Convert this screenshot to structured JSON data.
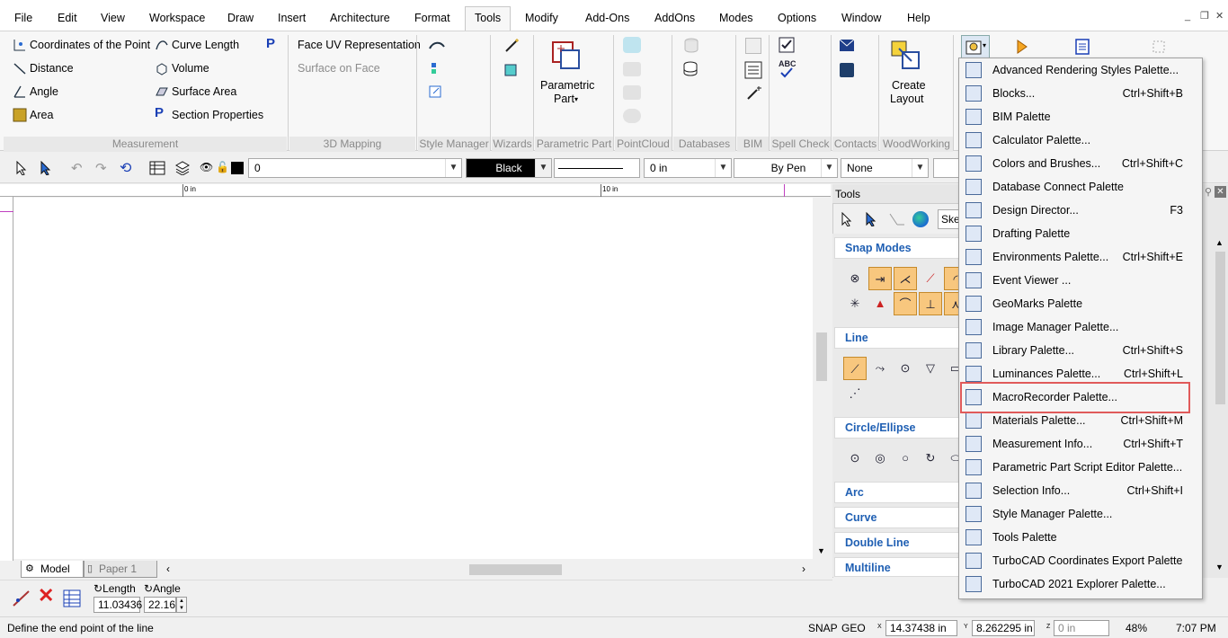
{
  "menubar": {
    "items": [
      "File",
      "Edit",
      "View",
      "Workspace",
      "Draw",
      "Insert",
      "Architecture",
      "Format",
      "Tools",
      "Modify",
      "Add-Ons",
      "AddOns",
      "Modes",
      "Options",
      "Window",
      "Help"
    ],
    "active": "Tools",
    "window_controls": [
      "_",
      "❐",
      "✕"
    ]
  },
  "ribbon": {
    "measurement": {
      "col1": [
        "Coordinates of the Point",
        "Distance",
        "Angle",
        "Area"
      ],
      "col2": [
        "Curve Length",
        "Volume",
        "Surface Area",
        "Section Properties"
      ]
    },
    "mapping": {
      "items": [
        "Face UV Representation",
        "Surface on Face"
      ]
    },
    "parametric_part": "Parametric\nPart",
    "parametric_line1": "Parametric",
    "parametric_line2": "Part",
    "create_layout_line1": "Create",
    "create_layout_line2": "Layout",
    "groups": [
      "Measurement",
      "3D Mapping",
      "Style Manager",
      "Wizards",
      "Parametric Part",
      "PointCloud",
      "Databases",
      "BIM",
      "Spell Check",
      "Contacts",
      "WoodWorking"
    ]
  },
  "toolbar": {
    "layer_value": "0",
    "color_value": "Black",
    "width_value": "0 in",
    "pen_value": "By Pen",
    "fill_value": "None"
  },
  "ruler": {
    "labels": [
      "0 in",
      "10 in"
    ]
  },
  "tools_palette": {
    "title": "Tools",
    "search_value": "Sket",
    "sections": [
      "Snap Modes",
      "Line",
      "Circle/Ellipse",
      "Arc",
      "Curve",
      "Double Line",
      "Multiline"
    ]
  },
  "dropdown": {
    "items": [
      {
        "label": "Advanced Rendering Styles Palette...",
        "shortcut": ""
      },
      {
        "label": "Blocks...",
        "shortcut": "Ctrl+Shift+B"
      },
      {
        "label": "BIM Palette",
        "shortcut": ""
      },
      {
        "label": "Calculator Palette...",
        "shortcut": ""
      },
      {
        "label": "Colors and Brushes...",
        "shortcut": "Ctrl+Shift+C"
      },
      {
        "label": "Database Connect Palette",
        "shortcut": ""
      },
      {
        "label": "Design Director...",
        "shortcut": "F3"
      },
      {
        "label": "Drafting Palette",
        "shortcut": ""
      },
      {
        "label": "Environments Palette...",
        "shortcut": "Ctrl+Shift+E"
      },
      {
        "label": "Event Viewer ...",
        "shortcut": ""
      },
      {
        "label": "GeoMarks Palette",
        "shortcut": ""
      },
      {
        "label": "Image Manager Palette...",
        "shortcut": ""
      },
      {
        "label": "Library Palette...",
        "shortcut": "Ctrl+Shift+S"
      },
      {
        "label": "Luminances Palette...",
        "shortcut": "Ctrl+Shift+L"
      },
      {
        "label": "MacroRecorder Palette...",
        "shortcut": ""
      },
      {
        "label": "Materials Palette...",
        "shortcut": "Ctrl+Shift+M"
      },
      {
        "label": "Measurement Info...",
        "shortcut": "Ctrl+Shift+T"
      },
      {
        "label": "Parametric Part Script Editor Palette...",
        "shortcut": ""
      },
      {
        "label": "Selection Info...",
        "shortcut": "Ctrl+Shift+I"
      },
      {
        "label": "Style Manager Palette...",
        "shortcut": ""
      },
      {
        "label": "Tools Palette",
        "shortcut": ""
      },
      {
        "label": "TurboCAD Coordinates Export Palette",
        "shortcut": ""
      },
      {
        "label": "TurboCAD 2021 Explorer Palette...",
        "shortcut": ""
      }
    ],
    "highlighted": "MacroRecorder Palette..."
  },
  "tabs": {
    "model": "Model",
    "paper": "Paper 1"
  },
  "inspector": {
    "length_label": "Length",
    "length_value": "11.03436",
    "angle_label": "Angle",
    "angle_value": "22.16"
  },
  "status": {
    "prompt": "Define the end point of the line",
    "snap": "SNAP",
    "geo": "GEO",
    "x_value": "14.37438 in",
    "y_value": "8.262295 in",
    "z_value": "0 in",
    "zoom": "48%",
    "time": "7:07 PM"
  },
  "colors": {
    "highlight_border": "#e05a5a",
    "section_title": "#1f5fb3",
    "snap_on": "#f8c77e"
  }
}
